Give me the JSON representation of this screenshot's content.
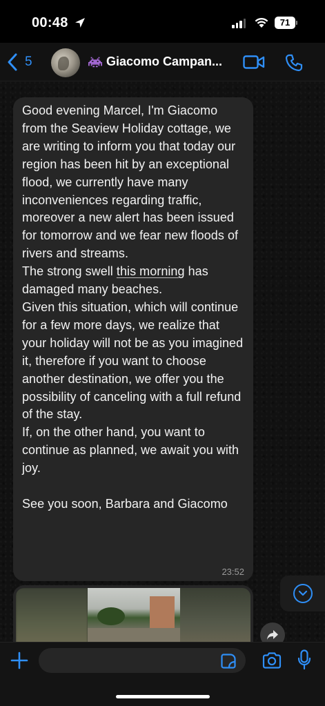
{
  "status_bar": {
    "time": "00:48",
    "battery": "71"
  },
  "header": {
    "back_count": "5",
    "contact_name": "Giacomo Campan...",
    "accent_color": "#2f8ff7"
  },
  "message": {
    "text_part1": "Good evening Marcel, I'm Giacomo from the Seaview Holiday cottage, we are writing to inform you that today our region has been hit by an exceptional flood, we currently have many inconveniences regarding traffic, moreover a new alert has been issued for tomorrow and we fear new floods of rivers and streams.\nThe strong swell ",
    "text_underlined": "this morning",
    "text_part2": " has damaged many beaches.\nGiven this situation, which will continue for a few more days, we realize that your holiday will not be as you imagined it, therefore if you want to choose another destination, we offer you the possibility of canceling with a full refund of the stay.\nIf, on the other hand, you want to continue as planned, we await you with joy.\n\nSee you soon, Barbara and Giacomo",
    "time": "23:52"
  },
  "input": {
    "value": "",
    "placeholder": ""
  },
  "icons": {
    "back": "chevron-left-icon",
    "video": "video-camera-icon",
    "call": "phone-icon",
    "plus": "plus-icon",
    "sticker": "sticker-icon",
    "camera": "camera-icon",
    "mic": "microphone-icon",
    "forward": "forward-arrow-icon",
    "scroll_down": "chevron-down-icon"
  }
}
